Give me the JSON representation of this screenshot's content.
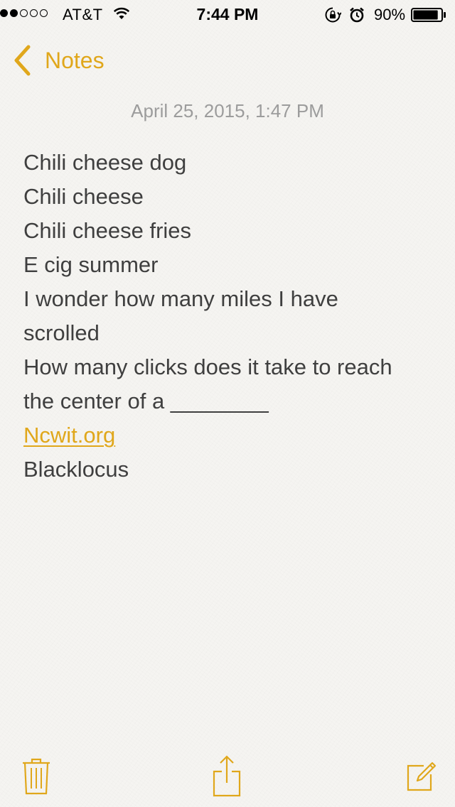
{
  "status_bar": {
    "signal_bars_filled": 2,
    "signal_bars_total": 5,
    "carrier": "AT&T",
    "time": "7:44 PM",
    "battery_percent": "90%",
    "battery_level": 0.9,
    "icons": [
      "wifi-icon",
      "rotation-lock-icon",
      "alarm-icon",
      "battery-icon"
    ]
  },
  "nav": {
    "back_label": "Notes",
    "accent_color": "#e0a71b"
  },
  "note": {
    "date": "April 25, 2015, 1:47 PM",
    "lines": [
      "Chili cheese dog",
      "Chili cheese",
      "Chili cheese fries",
      "E cig summer",
      "I wonder how many miles I have",
      "scrolled",
      "How many clicks does it take to reach",
      "the center of a ________"
    ],
    "link": "Ncwit.org",
    "last_line": "Blacklocus"
  },
  "toolbar": {
    "icons": [
      "trash-icon",
      "share-icon",
      "compose-icon"
    ]
  }
}
